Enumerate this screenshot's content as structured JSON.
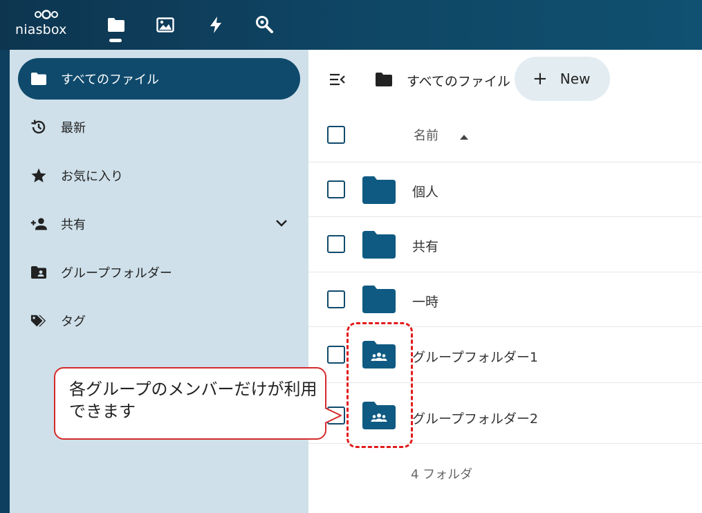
{
  "header": {
    "logo_text": "niasbox",
    "apps": [
      {
        "name": "files",
        "icon": "folder-icon",
        "active": true
      },
      {
        "name": "photos",
        "icon": "image-icon"
      },
      {
        "name": "activity",
        "icon": "lightning-icon"
      },
      {
        "name": "search",
        "icon": "search-icon"
      }
    ]
  },
  "sidebar": {
    "items": [
      {
        "label": "すべてのファイル",
        "icon": "folder-icon",
        "active": true
      },
      {
        "label": "最新",
        "icon": "history-icon"
      },
      {
        "label": "お気に入り",
        "icon": "star-icon"
      },
      {
        "label": "共有",
        "icon": "share-person-icon",
        "expandable": true
      },
      {
        "label": "グループフォルダー",
        "icon": "group-folder-icon"
      },
      {
        "label": "タグ",
        "icon": "tag-icon"
      }
    ]
  },
  "toolbar": {
    "breadcrumb": "すべてのファイル",
    "new_label": "New"
  },
  "table": {
    "column_name": "名前",
    "rows": [
      {
        "name": "個人",
        "type": "folder"
      },
      {
        "name": "共有",
        "type": "folder"
      },
      {
        "name": "一時",
        "type": "folder"
      },
      {
        "name": "グループフォルダー1",
        "type": "group-folder"
      },
      {
        "name": "グループフォルダー2",
        "type": "group-folder"
      }
    ],
    "summary": "4 フォルダ"
  },
  "annotation": {
    "callout_text": "各グループのメンバーだけが利用できます"
  },
  "colors": {
    "header_bg": "#0f4766",
    "sidebar_bg": "#cfe0ea",
    "accent": "#0f4a6c",
    "annotation_red": "#e21b1b"
  }
}
